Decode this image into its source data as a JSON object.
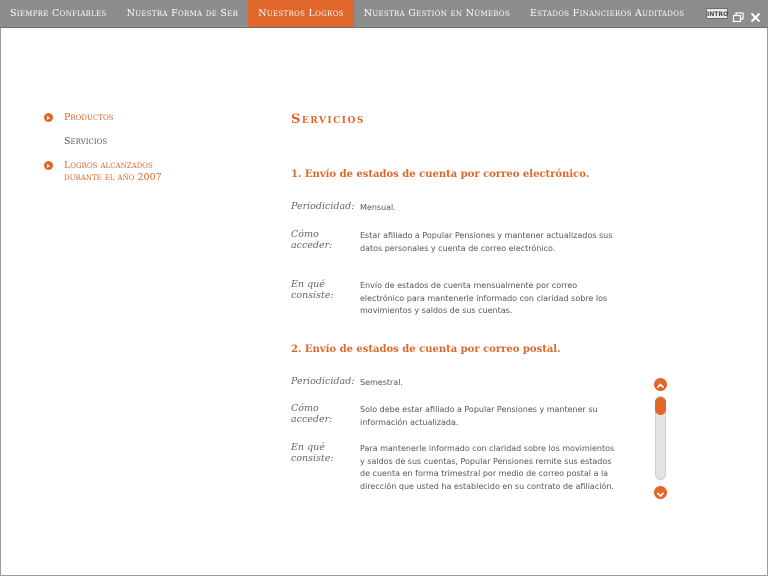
{
  "nav": {
    "tabs": [
      {
        "label": "Siempre Confiables",
        "active": false
      },
      {
        "label": "Nuestra Forma de Ser",
        "active": false
      },
      {
        "label": "Nuestros Logros",
        "active": true
      },
      {
        "label": "Nuestra Gestión en Números",
        "active": false
      },
      {
        "label": "Estados Financieros Auditados",
        "active": false
      }
    ],
    "intro_label": "INTRO"
  },
  "sidebar": {
    "items": [
      {
        "label": "Productos",
        "bullet": true
      },
      {
        "label": "Servicios",
        "bullet": false
      },
      {
        "label": "Logros alcanzados",
        "label2": "durante el año 2007",
        "bullet": true
      }
    ]
  },
  "main": {
    "title": "Servicios",
    "sections": [
      {
        "heading": "1. Envío de estados de cuenta por correo electrónico.",
        "rows": [
          {
            "label": "Periodicidad:",
            "value": "Mensual."
          },
          {
            "label": "Cómo acceder:",
            "value": "Estar afiliado a Popular Pensiones y mantener actualizados sus datos personales y cuenta de correo electrónico."
          },
          {
            "label": "En qué consiste:",
            "value": "Envío de estados de cuenta mensualmente por correo electrónico para mantenerle informado con claridad sobre los movimientos y saldos de sus cuentas."
          }
        ]
      },
      {
        "heading": "2. Envío de estados de cuenta por correo postal.",
        "rows": [
          {
            "label": "Periodicidad:",
            "value": "Semestral."
          },
          {
            "label": "Cómo acceder:",
            "value": "Solo debe estar afiliado a Popular Pensiones y mantener su información actualizada."
          },
          {
            "label": "En qué consiste:",
            "value": "Para mantenerle informado con claridad sobre los movimientos y saldos de sus cuentas, Popular Pensiones remite sus estados de cuenta en forma trimestral por medio de correo postal a la dirección que usted ha establecido en su contrato de afiliación."
          }
        ]
      }
    ]
  },
  "colors": {
    "accent": "#e0662a",
    "nav_bg": "#8d8d8d",
    "text": "#555555"
  }
}
